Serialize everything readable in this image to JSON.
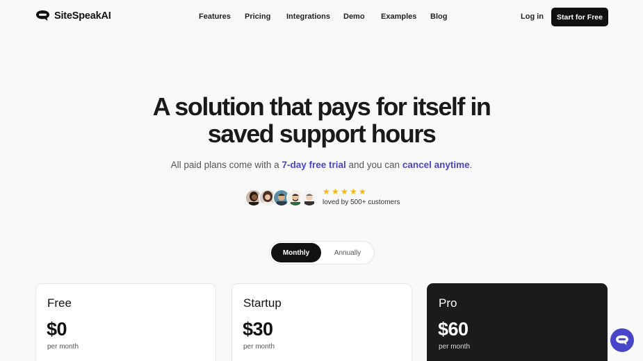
{
  "brand": {
    "name": "SiteSpeakAI",
    "icon": "chat-bubble-logo-icon"
  },
  "nav": {
    "links": [
      "Features",
      "Pricing",
      "Integrations",
      "Demo",
      "Examples",
      "Blog"
    ],
    "login": "Log in",
    "cta": "Start for Free"
  },
  "hero": {
    "headline_line1": "A solution that pays for itself in",
    "headline_line2": "saved support hours",
    "sub_prefix": "All paid plans come with a ",
    "sub_trial": "7-day free trial",
    "sub_middle": " and you can ",
    "sub_cancel": "cancel anytime",
    "sub_suffix": "."
  },
  "social": {
    "stars": 5,
    "text": "loved by 500+ customers"
  },
  "billing_toggle": {
    "monthly": "Monthly",
    "annually": "Annually",
    "selected": "Monthly"
  },
  "plans": [
    {
      "name": "Free",
      "price": "$0",
      "period": "per month"
    },
    {
      "name": "Startup",
      "price": "$30",
      "period": "per month"
    },
    {
      "name": "Pro",
      "price": "$60",
      "period": "per month"
    }
  ],
  "colors": {
    "accent": "#4746c8",
    "dark": "#111111",
    "star": "#f5b800",
    "background": "#f9f9f9"
  }
}
